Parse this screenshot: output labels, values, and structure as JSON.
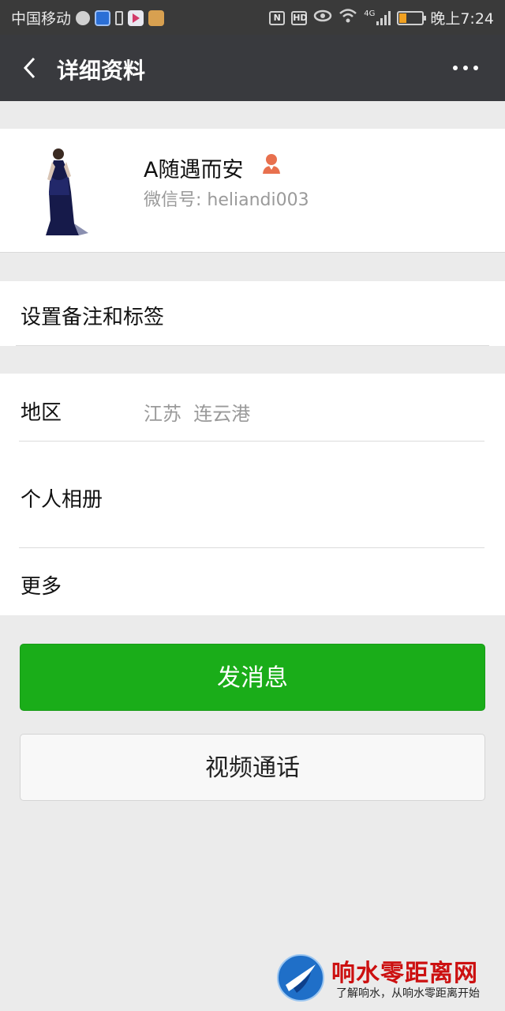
{
  "status_bar": {
    "carrier": "中国移动",
    "network": "4G",
    "hd_label": "HD",
    "nfc_label": "N",
    "time": "晚上7:24"
  },
  "nav": {
    "back_icon": "chevron-left-icon",
    "title": "详细资料",
    "more_icon": "more-dots-icon"
  },
  "profile": {
    "name": "A随遇而安",
    "gender_icon": "female-person-icon",
    "wechat_id": "微信号: heliandi003"
  },
  "remark_row": {
    "label": "设置备注和标签"
  },
  "info_rows": [
    {
      "label": "地区",
      "value": "江苏  连云港"
    },
    {
      "label": "个人相册",
      "value": ""
    },
    {
      "label": "更多",
      "value": ""
    }
  ],
  "actions": {
    "send_message": "发消息",
    "video_call": "视频通话"
  },
  "watermark": {
    "title": "响水零距离网",
    "subtitle": "了解响水，从响水零距离开始"
  },
  "colors": {
    "nav_bg": "#393a3e",
    "primary_green": "#1aad19",
    "page_bg": "#ebebeb",
    "gender_icon": "#e8704e"
  }
}
